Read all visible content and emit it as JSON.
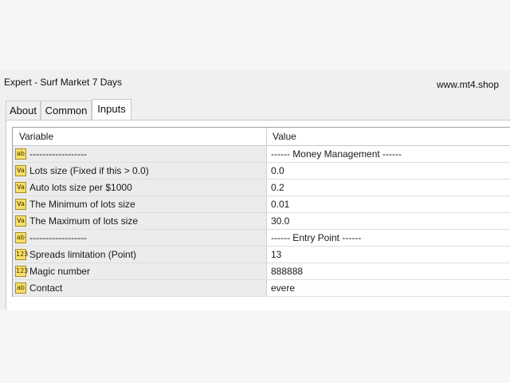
{
  "window": {
    "title": "Expert - Surf Market 7 Days",
    "watermark": "www.mt4.shop"
  },
  "tabs": [
    {
      "label": "About"
    },
    {
      "label": "Common"
    },
    {
      "label": "Inputs",
      "active": true
    }
  ],
  "grid": {
    "headers": {
      "variable": "Variable",
      "value": "Value"
    },
    "rows": [
      {
        "icon": "ab-icon",
        "variable": "------------------",
        "value": "------ Money Management ------"
      },
      {
        "icon": "va-icon",
        "variable": "Lots size (Fixed if this > 0.0)",
        "value": "0.0"
      },
      {
        "icon": "va-icon",
        "variable": "Auto lots size per $1000",
        "value": "0.2"
      },
      {
        "icon": "va-icon",
        "variable": "The Minimum of lots size",
        "value": "0.01"
      },
      {
        "icon": "va-icon",
        "variable": "The Maximum of lots size",
        "value": "30.0"
      },
      {
        "icon": "ab-icon",
        "variable": "------------------",
        "value": "------ Entry Point ------"
      },
      {
        "icon": "123-icon",
        "variable": "Spreads limitation (Point)",
        "value": "13"
      },
      {
        "icon": "123-icon",
        "variable": "Magic number",
        "value": "888888"
      },
      {
        "icon": "ab-icon",
        "variable": "Contact",
        "value": "evere"
      }
    ]
  },
  "icons": {
    "ab": "ab",
    "va": "Va",
    "num": "123"
  }
}
